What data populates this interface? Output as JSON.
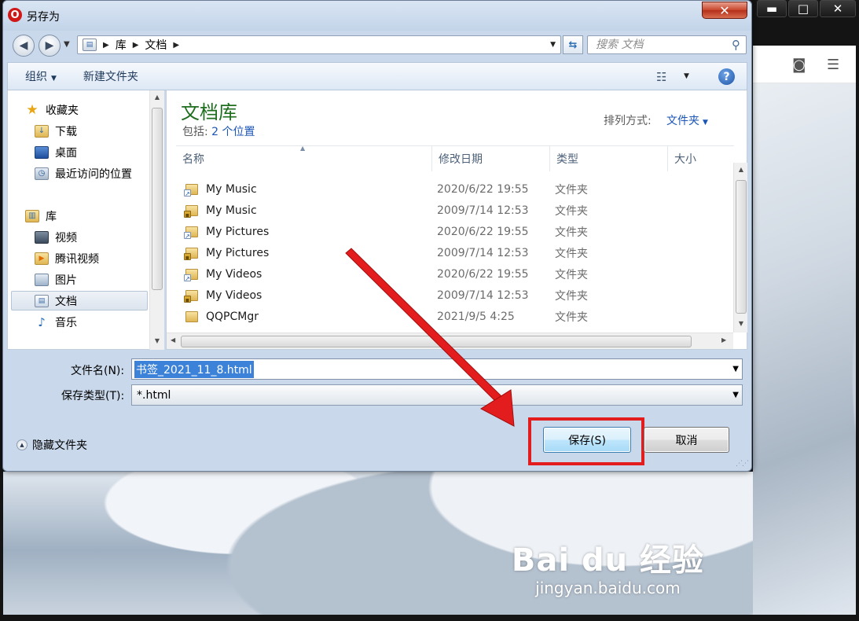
{
  "dialog": {
    "title": "另存为",
    "close_glyph": "✕"
  },
  "background": {
    "minimize_glyph": "▬",
    "maximize_glyph": "□",
    "close_glyph": "✕",
    "watermark_logo": "Bai du 经验",
    "watermark_url": "jingyan.baidu.com"
  },
  "address": {
    "crumbs": [
      "库",
      "文档"
    ],
    "search_placeholder": "搜索 文档"
  },
  "toolbar": {
    "organize": "组织",
    "new_folder": "新建文件夹"
  },
  "nav": {
    "items": [
      {
        "label": "收藏夹",
        "icon": "star-icon"
      },
      {
        "label": "下载",
        "icon": "download-folder-icon"
      },
      {
        "label": "桌面",
        "icon": "desktop-icon"
      },
      {
        "label": "最近访问的位置",
        "icon": "recent-places-icon"
      },
      {
        "label": "库",
        "icon": "library-icon"
      },
      {
        "label": "视频",
        "icon": "video-library-icon"
      },
      {
        "label": "腾讯视频",
        "icon": "tencent-video-icon"
      },
      {
        "label": "图片",
        "icon": "pictures-library-icon"
      },
      {
        "label": "文档",
        "icon": "documents-library-icon"
      },
      {
        "label": "音乐",
        "icon": "music-library-icon"
      }
    ]
  },
  "library": {
    "title": "文档库",
    "includes_label": "包括:",
    "includes_link": "2 个位置",
    "arrange_label": "排列方式:",
    "arrange_value": "文件夹"
  },
  "columns": [
    "名称",
    "修改日期",
    "类型",
    "大小"
  ],
  "files": [
    {
      "name": "My Music",
      "date": "2020/6/22 19:55",
      "type": "文件夹",
      "overlay": "link"
    },
    {
      "name": "My Music",
      "date": "2009/7/14 12:53",
      "type": "文件夹",
      "overlay": "lock"
    },
    {
      "name": "My Pictures",
      "date": "2020/6/22 19:55",
      "type": "文件夹",
      "overlay": "link"
    },
    {
      "name": "My Pictures",
      "date": "2009/7/14 12:53",
      "type": "文件夹",
      "overlay": "lock"
    },
    {
      "name": "My Videos",
      "date": "2020/6/22 19:55",
      "type": "文件夹",
      "overlay": "link"
    },
    {
      "name": "My Videos",
      "date": "2009/7/14 12:53",
      "type": "文件夹",
      "overlay": "lock"
    },
    {
      "name": "QQPCMgr",
      "date": "2021/9/5 4:25",
      "type": "文件夹",
      "overlay": "none"
    }
  ],
  "form": {
    "filename_label": "文件名(N):",
    "filename_value": "书签_2021_11_8.html",
    "filetype_label": "保存类型(T):",
    "filetype_value": "*.html"
  },
  "footer": {
    "hide_folders": "隐藏文件夹",
    "save": "保存(S)",
    "cancel": "取消"
  },
  "colors": {
    "highlight_red": "#e31d1d",
    "library_title_green": "#1e6e1e",
    "link_blue": "#1b55b6"
  }
}
